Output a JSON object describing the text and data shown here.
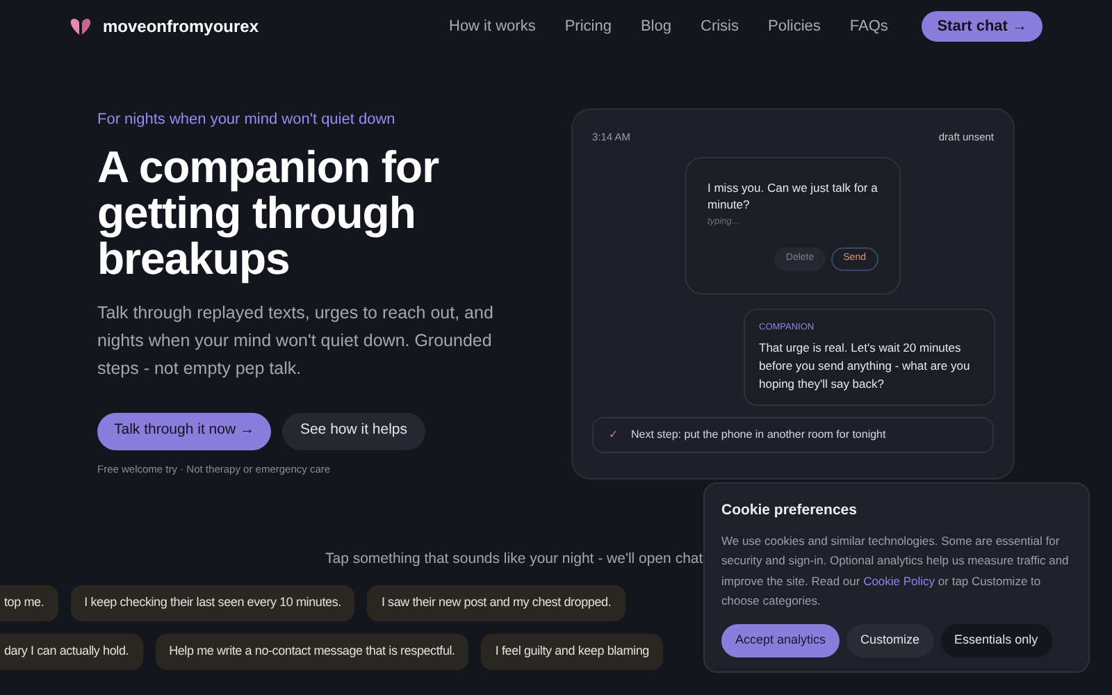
{
  "brand": {
    "name": "moveonfromyourex"
  },
  "nav": [
    {
      "label": "How it works"
    },
    {
      "label": "Pricing"
    },
    {
      "label": "Blog"
    },
    {
      "label": "Crisis"
    },
    {
      "label": "Policies"
    },
    {
      "label": "FAQs"
    }
  ],
  "nav_cta": {
    "label": "Start chat",
    "arrow": "→"
  },
  "hero": {
    "eyebrow": "For nights when your mind won't quiet down",
    "title": "A companion for getting through breakups",
    "text": "Talk through replayed texts, urges to reach out, and nights when your mind won't quiet down. Grounded steps - not empty pep talk.",
    "primary": {
      "label": "Talk through it now",
      "arrow": "→"
    },
    "secondary": {
      "label": "See how it helps"
    },
    "note": "Free welcome try · Not therapy or emergency care"
  },
  "chat_card": {
    "time": "3:14 AM",
    "status": "draft unsent",
    "draft": {
      "text": "I miss you. Can we just talk for a minute?",
      "hint": "typing...",
      "buttons": [
        {
          "label": "Delete",
          "kind": "ghost"
        },
        {
          "label": "Send",
          "kind": "outline"
        }
      ]
    },
    "reply": {
      "label": "COMPANION",
      "text": "That urge is real. Let's wait 20 minutes before you send anything - what are you hoping they'll say back?"
    },
    "next_step": {
      "mark": "✓",
      "text": "Next step: put the phone in another room for tonight"
    }
  },
  "prompt_line": "Tap something that sounds like your night - we'll open chat",
  "chip_rows": [
    [
      "top me.",
      "I keep checking their last seen every 10 minutes.",
      "I saw their new post and my chest dropped."
    ],
    [
      "dary I can actually hold.",
      "Help me write a no-contact message that is respectful.",
      "I feel guilty and keep blaming"
    ]
  ],
  "cookie": {
    "title": "Cookie preferences",
    "text_before": "We use cookies and similar technologies. Some are essential for security and sign-in. Optional analytics help us measure traffic and improve the site. Read our ",
    "link": "Cookie Policy",
    "text_after": " or tap Customize to choose categories.",
    "buttons": [
      {
        "label": "Accept analytics",
        "kind": "primary"
      },
      {
        "label": "Customize",
        "kind": "secondary"
      },
      {
        "label": "Essentials only",
        "kind": "dark"
      }
    ]
  }
}
